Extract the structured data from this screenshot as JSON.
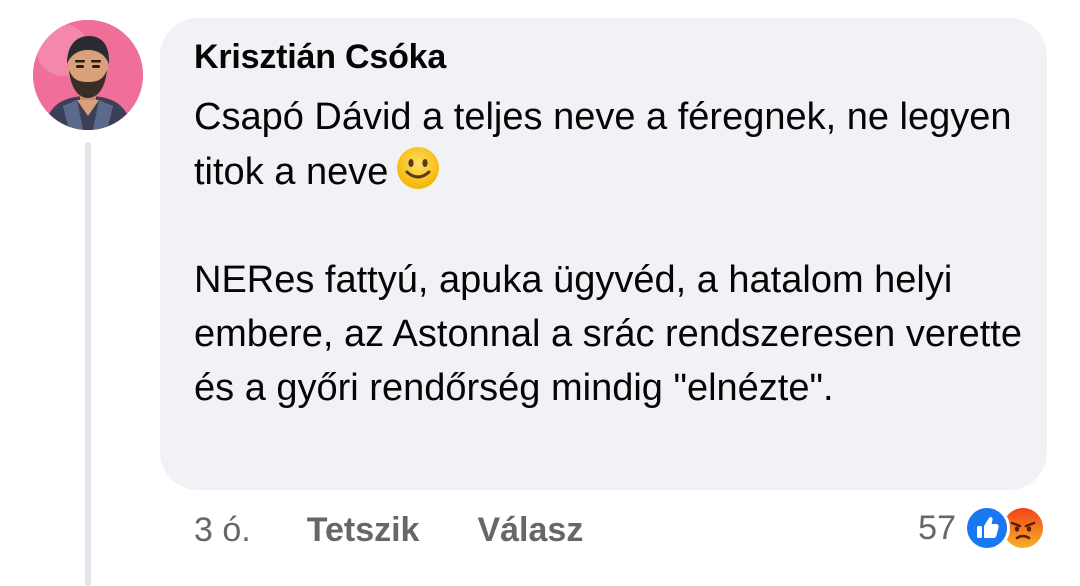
{
  "comment": {
    "author": "Krisztián Csóka",
    "paragraphs": [
      "Csapó Dávid a teljes neve a féregnek, ne legyen titok a neve",
      "NERes fattyú, apuka ügyvéd, a hatalom helyi embere, az Astonnal a srác rendszeresen verette és a győri rendőrség mindig \"elnézte\"."
    ],
    "emoji": "smiling-face-icon"
  },
  "actions": {
    "time": "3 ó.",
    "like_label": "Tetszik",
    "reply_label": "Válasz"
  },
  "reactions": {
    "count": "57",
    "icons": [
      "like-icon",
      "angry-icon"
    ]
  },
  "colors": {
    "bubble": "#f0f2f5",
    "text": "#050505",
    "meta": "#65676b",
    "like_blue": "#1877f2",
    "avatar_bg": "#ef6f98"
  }
}
